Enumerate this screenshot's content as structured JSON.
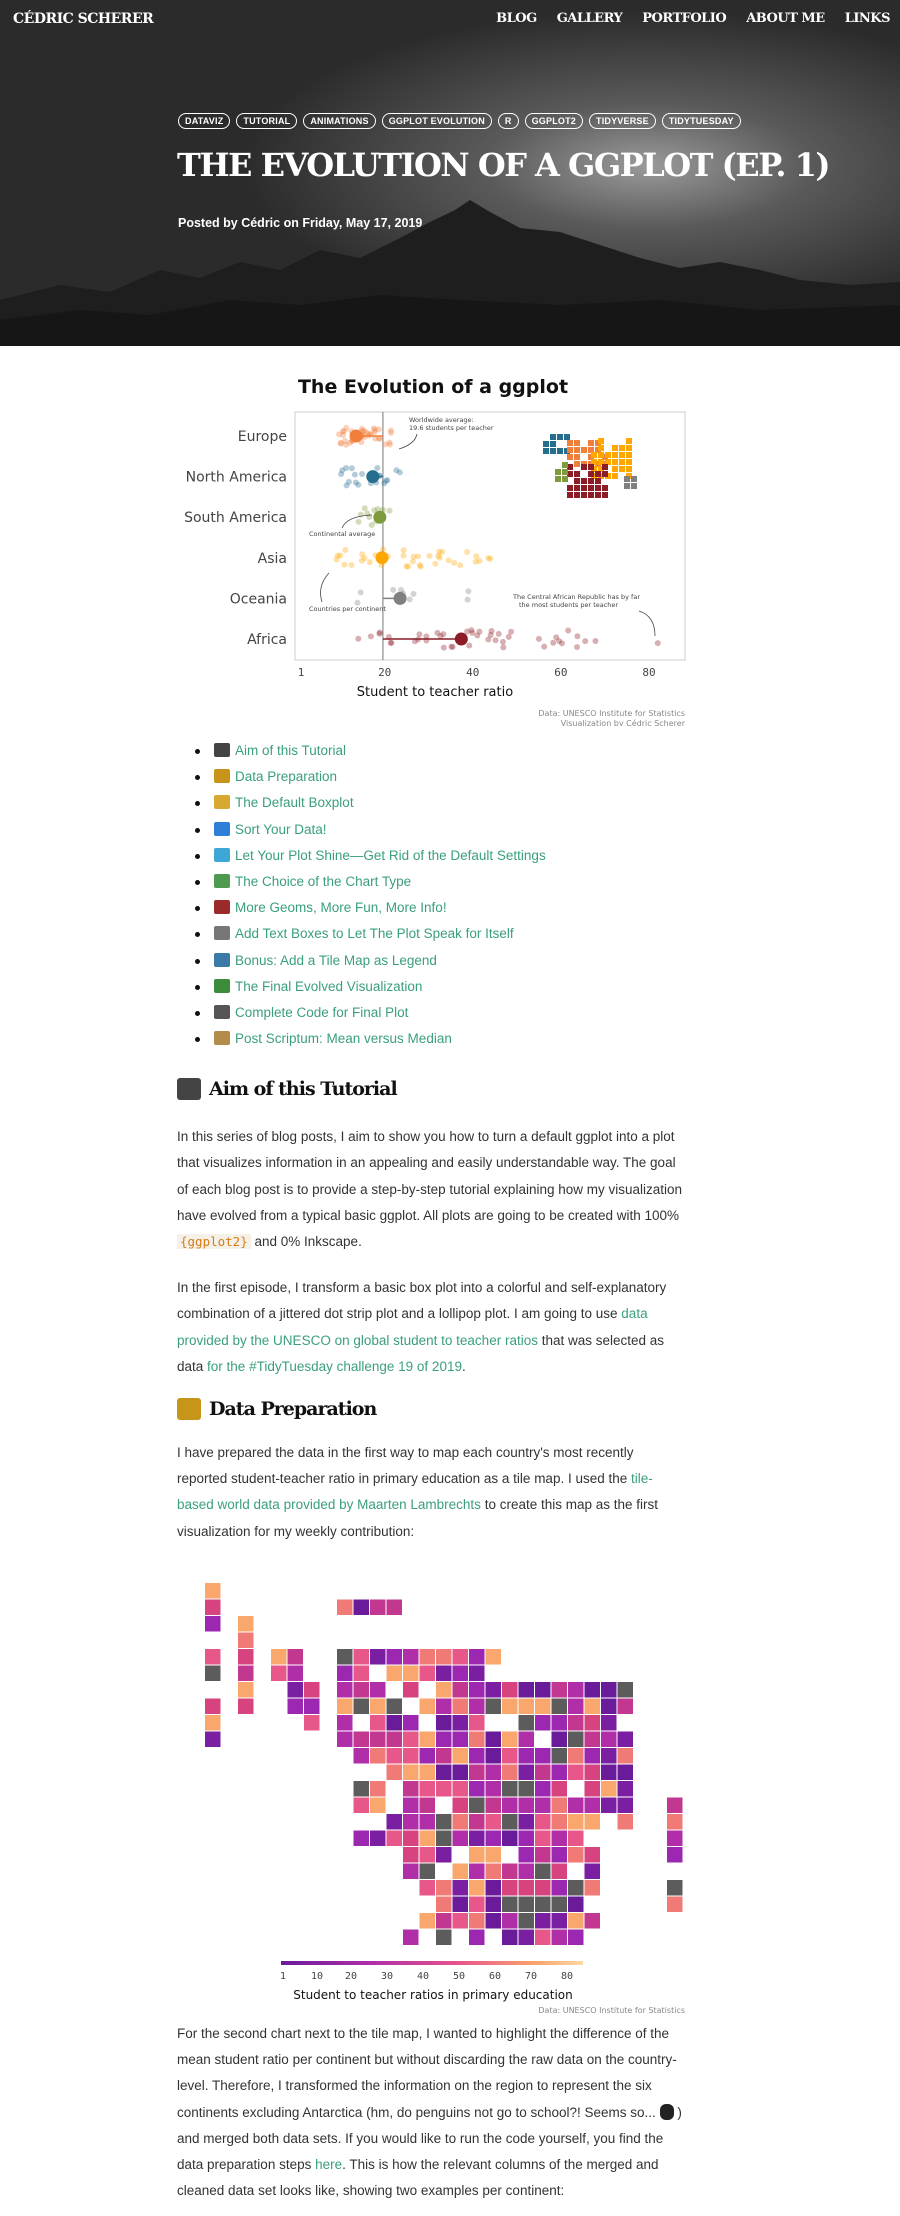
{
  "nav": {
    "brand": "Cédric Scherer",
    "links": [
      "Blog",
      "Gallery",
      "Portfolio",
      "About me",
      "Links"
    ]
  },
  "post": {
    "tags": [
      "dataviz",
      "tutorial",
      "animations",
      "ggplot evolution",
      "R",
      "ggplot2",
      "tidyverse",
      "TidyTuesday"
    ],
    "title": "The Evolution of a ggplot (Ep. 1)",
    "meta": "Posted by Cédric on Friday, May 17, 2019"
  },
  "chart1": {
    "title": "The Evolution of a ggplot",
    "categories": [
      "Europe",
      "North America",
      "South America",
      "Asia",
      "Oceania",
      "Africa"
    ],
    "xticks": [
      "1",
      "20",
      "40",
      "60",
      "80"
    ],
    "xlabel": "Student to teacher ratio",
    "annotations": {
      "worldwide1": "Worldwide average:",
      "worldwide2": "19.6 students per teacher",
      "continental": "Continental average",
      "countries": "Countries per continent",
      "car1": "The Central African Republic has by far",
      "car2": "the most students per teacher"
    },
    "caption1": "Data: UNESCO Institute for Statistics",
    "caption2": "Visualization by Cédric Scherer",
    "colors": [
      "#f07f3c",
      "#256e8e",
      "#7d9b3d",
      "#ffa600",
      "#808080",
      "#8c1c26"
    ]
  },
  "chart_data": {
    "type": "scatter",
    "title": "The Evolution of a ggplot",
    "xlabel": "Student to teacher ratio",
    "ylabel": "",
    "categories": [
      "Europe",
      "North America",
      "South America",
      "Asia",
      "Oceania",
      "Africa"
    ],
    "continent_means": [
      13.5,
      17.3,
      18.9,
      19.4,
      23.5,
      37.4
    ],
    "worldwide_average": 19.6,
    "xlim": [
      1,
      85
    ]
  },
  "toc": [
    {
      "label": "Aim of this Tutorial",
      "color": "#444"
    },
    {
      "label": "Data Preparation",
      "color": "#c8951b"
    },
    {
      "label": "The Default Boxplot",
      "color": "#d8a92e"
    },
    {
      "label": "Sort Your Data!",
      "color": "#2f7fd8"
    },
    {
      "label": "Let Your Plot Shine—Get Rid of the Default Settings",
      "color": "#3fa7d6"
    },
    {
      "label": "The Choice of the Chart Type",
      "color": "#4e9a4e"
    },
    {
      "label": "More Geoms, More Fun, More Info!",
      "color": "#9b2b2b"
    },
    {
      "label": "Add Text Boxes to Let The Plot Speak for Itself",
      "color": "#777"
    },
    {
      "label": "Bonus: Add a Tile Map as Legend",
      "color": "#3b7aa8"
    },
    {
      "label": "The Final Evolved Visualization",
      "color": "#3c8c3c"
    },
    {
      "label": "Complete Code for Final Plot",
      "color": "#555"
    },
    {
      "label": "Post Scriptum: Mean versus Median",
      "color": "#b38b4a"
    }
  ],
  "section1": {
    "heading": "Aim of this Tutorial",
    "p1a": "In this series of blog posts, I aim to show you how to turn a default ggplot into a plot that visualizes information in an appealing and easily understandable way. The goal of each blog post is to provide a step-by-step tutorial explaining how my visualization have evolved from a typical basic ggplot. All plots are going to be created with 100%",
    "p1code": "{ggplot2}",
    "p1b": "and 0% Inkscape.",
    "p2a": "In the first episode, I transform a basic box plot into a colorful and self-explanatory combination of a jittered dot strip plot and a lollipop plot. I am going to use",
    "p2link1": "data provided by the UNESCO on global student to teacher ratios",
    "p2b": "that was selected as data",
    "p2link2": "for the #TidyTuesday challenge 19 of 2019",
    "p2c": "."
  },
  "section2": {
    "heading": "Data Preparation",
    "p1a": "I have prepared the data in the first way to map each country's most recently reported student-teacher ratio in primary education as a tile map. I used the",
    "p1link": "tile-based world data provided by Maarten Lambrechts",
    "p1b": "to create this map as the first visualization for my weekly contribution:"
  },
  "tilemap": {
    "legend_ticks": [
      "1",
      "10",
      "20",
      "30",
      "40",
      "50",
      "60",
      "70",
      "80"
    ],
    "legend_title": "Student to teacher ratios in primary education",
    "caption": "Data: UNESCO Institute for Statistics"
  },
  "section3": {
    "p1a": "For the second chart next to the tile map, I wanted to highlight the difference of the mean student ratio per continent but without discarding the raw data on the country-level. Therefore, I transformed the information on the region to represent the six continents excluding Antarctica (hm, do penguins not go to school?! Seems so...",
    "p1b": ") and merged both data sets. If you would like to run the code yourself, you find the data preparation steps",
    "p1link": "here",
    "p1c": ". This is how the relevant columns of the merged and cleaned data set looks like, showing two examples per continent:"
  }
}
